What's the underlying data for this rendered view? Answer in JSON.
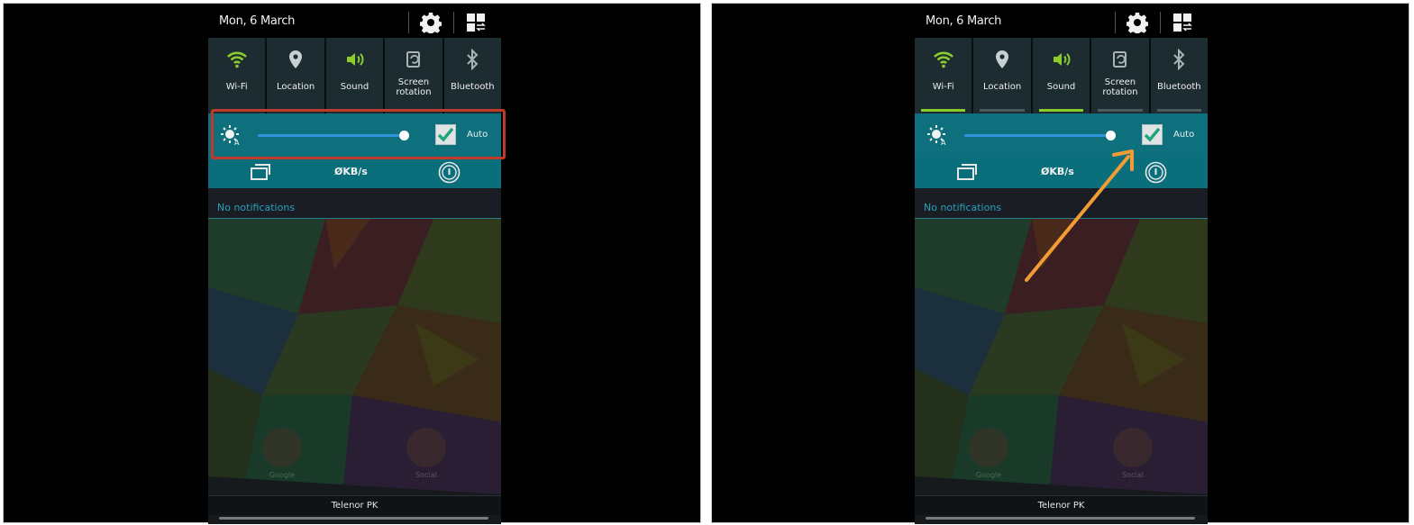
{
  "status_bar": {
    "date": "Mon, 6 March"
  },
  "quick_toggles": [
    {
      "id": "wifi",
      "label": "Wi-Fi",
      "icon": "wifi-icon",
      "active": true
    },
    {
      "id": "location",
      "label": "Location",
      "icon": "location-pin-icon",
      "active": false
    },
    {
      "id": "sound",
      "label": "Sound",
      "icon": "speaker-icon",
      "active": true
    },
    {
      "id": "rotation",
      "label": "Screen rotation",
      "label_line1": "Screen",
      "label_line2": "rotation",
      "icon": "screen-rotation-icon",
      "active": false
    },
    {
      "id": "bluetooth",
      "label": "Bluetooth",
      "icon": "bluetooth-icon",
      "active": false
    }
  ],
  "brightness": {
    "auto_label": "Auto",
    "auto_checked": true,
    "level": 0.97
  },
  "network": {
    "speed": "ØKB/s"
  },
  "notifications": {
    "empty_text": "No notifications"
  },
  "home_apps": [
    {
      "label": "Google"
    },
    {
      "label": "Social"
    }
  ],
  "carrier": "Telenor PK",
  "colors": {
    "accent_green": "#8acd2b",
    "teal_bar": "#0f707d",
    "slider_blue": "#2e95d8",
    "highlight_red": "#c0392b",
    "arrow_orange": "#f39c35"
  }
}
